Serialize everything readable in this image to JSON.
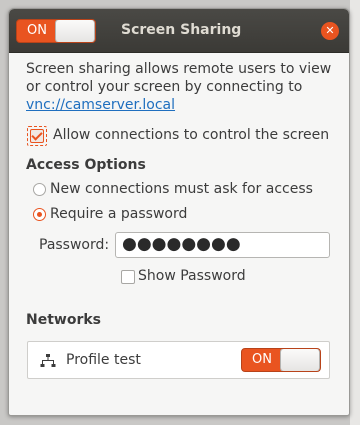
{
  "window": {
    "title": "Screen Sharing",
    "master_switch": {
      "state_label": "ON",
      "on": true
    },
    "close_icon": "close-icon"
  },
  "description": {
    "text": "Screen sharing allows remote users to view or control your screen by connecting to ",
    "link": "vnc://camserver.local"
  },
  "allow_control": {
    "label": "Allow connections to control the screen",
    "checked": true
  },
  "access_options": {
    "heading": "Access Options",
    "options": [
      {
        "label": "New connections must ask for access",
        "selected": false
      },
      {
        "label": "Require a password",
        "selected": true
      }
    ]
  },
  "password": {
    "label": "Password:",
    "value": "●●●●●●●●",
    "show_label": "Show Password",
    "show_checked": false
  },
  "networks": {
    "heading": "Networks",
    "items": [
      {
        "name": "Profile test",
        "switch_label": "ON",
        "on": true,
        "icon": "network-wired-icon"
      }
    ]
  },
  "colors": {
    "accent": "#e95420",
    "titlebar": "#3b3a36",
    "link": "#1f6fbf"
  }
}
